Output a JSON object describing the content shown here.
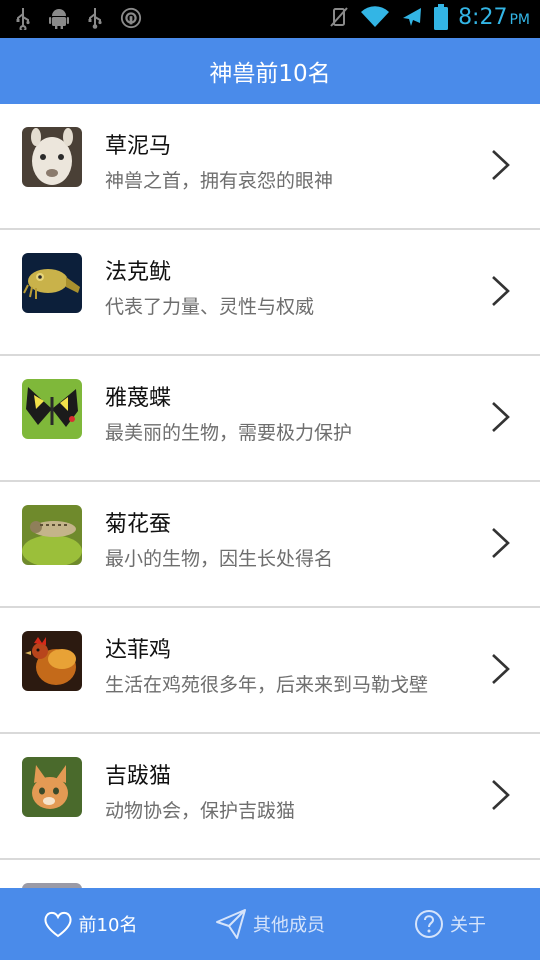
{
  "status_bar": {
    "time": "8:27",
    "ampm": "PM",
    "left_icons": [
      "usb-icon",
      "android-icon",
      "usb-icon",
      "sync-icon"
    ],
    "right_icons": [
      "vibrate-off-icon",
      "wifi-icon",
      "airplane-icon",
      "battery-icon"
    ],
    "accent_color": "#33b5e5"
  },
  "header": {
    "title": "神兽前10名",
    "color": "#4a8bea"
  },
  "list": {
    "items": [
      {
        "title": "草泥马",
        "subtitle": "神兽之首，拥有哀怨的眼神",
        "icon": "alpaca-thumbnail"
      },
      {
        "title": "法克鱿",
        "subtitle": "代表了力量、灵性与权威",
        "icon": "cuttlefish-thumbnail"
      },
      {
        "title": "雅蔑蝶",
        "subtitle": "最美丽的生物，需要极力保护",
        "icon": "butterfly-thumbnail"
      },
      {
        "title": "菊花蚕",
        "subtitle": "最小的生物，因生长处得名",
        "icon": "caterpillar-thumbnail"
      },
      {
        "title": "达菲鸡",
        "subtitle": "生活在鸡苑很多年，后来来到马勒戈壁",
        "icon": "rooster-thumbnail"
      },
      {
        "title": "吉跋猫",
        "subtitle": "动物协会，保护吉跋猫",
        "icon": "kitten-thumbnail"
      }
    ]
  },
  "tabbar": {
    "tabs": [
      {
        "label": "前10名",
        "icon": "heart-icon",
        "active": true
      },
      {
        "label": "其他成员",
        "icon": "paper-plane-icon",
        "active": false
      },
      {
        "label": "关于",
        "icon": "question-circle-icon",
        "active": false
      }
    ]
  }
}
